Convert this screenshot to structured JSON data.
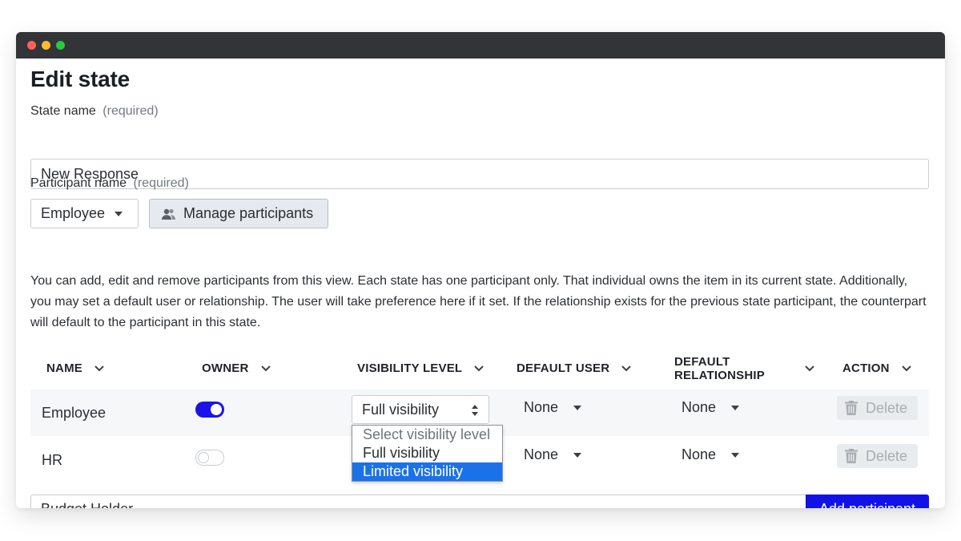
{
  "page": {
    "title": "Edit state"
  },
  "state_name": {
    "label": "State name",
    "required": "(required)",
    "value": "New Response"
  },
  "participant": {
    "label": "Participant name",
    "required": "(required)",
    "selected": "Employee",
    "manage_label": "Manage participants"
  },
  "description": "You can add, edit and remove participants from this view. Each state has one participant only. That individual owns the item in its current state. Additionally, you may set a default user or relationship. The user will take preference here if it set. If the relationship exists for the previous state participant, the counterpart will default to the participant in this state.",
  "table": {
    "headers": {
      "name": "NAME",
      "owner": "OWNER",
      "visibility": "VISIBILITY LEVEL",
      "default_user": "DEFAULT USER",
      "default_relationship_1": "DEFAULT",
      "default_relationship_2": "RELATIONSHIP",
      "action": "ACTION"
    },
    "rows": [
      {
        "name": "Employee",
        "owner": true,
        "visibility": "Full visibility",
        "default_user": "None",
        "default_relationship": "None",
        "action": "Delete"
      },
      {
        "name": "HR",
        "owner": false,
        "visibility": "",
        "default_user": "None",
        "default_relationship": "None",
        "action": "Delete"
      }
    ],
    "visibility_dropdown": {
      "options": [
        "Select visibility level",
        "Full visibility",
        "Limited visibility"
      ],
      "highlighted": "Limited visibility"
    }
  },
  "add_participant": {
    "value": "Budget Holder",
    "button_label": "Add participant"
  },
  "colors": {
    "accent": "#1212e8",
    "toggle_on": "#1a14ea",
    "dropdown_highlight": "#1b72e8",
    "titlebar": "#333437"
  }
}
